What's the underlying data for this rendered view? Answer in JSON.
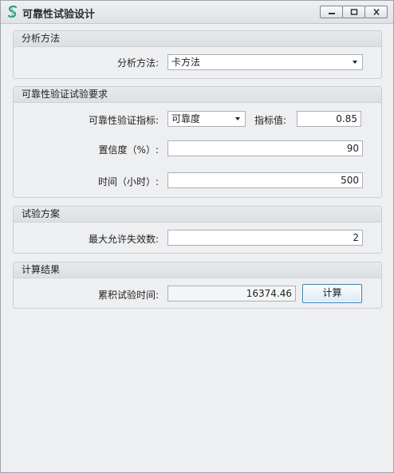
{
  "window": {
    "title": "可靠性试验设计",
    "icon": "app-s-icon",
    "controls": [
      "minimize-icon",
      "maximize-icon",
      "close-icon"
    ]
  },
  "analysis_group": {
    "header": "分析方法",
    "method_label": "分析方法:",
    "method_value": "卡方法"
  },
  "requirements_group": {
    "header": "可靠性验证试验要求",
    "indicator_label": "可靠性验证指标:",
    "indicator_value": "可靠度",
    "index_value_label": "指标值:",
    "index_value": "0.85",
    "confidence_label": "置信度（%）:",
    "confidence_value": "90",
    "time_label": "时间（小时）:",
    "time_value": "500"
  },
  "plan_group": {
    "header": "试验方案",
    "max_failures_label": "最大允许失效数:",
    "max_failures_value": "2"
  },
  "result_group": {
    "header": "计算结果",
    "cumulative_time_label": "累积试验时间:",
    "cumulative_time_value": "16374.46",
    "calculate_button": "计算"
  },
  "colors": {
    "window_bg": "#eeeff1",
    "title_icon": "#2e9e7a",
    "button_border": "#3c7fb1"
  }
}
